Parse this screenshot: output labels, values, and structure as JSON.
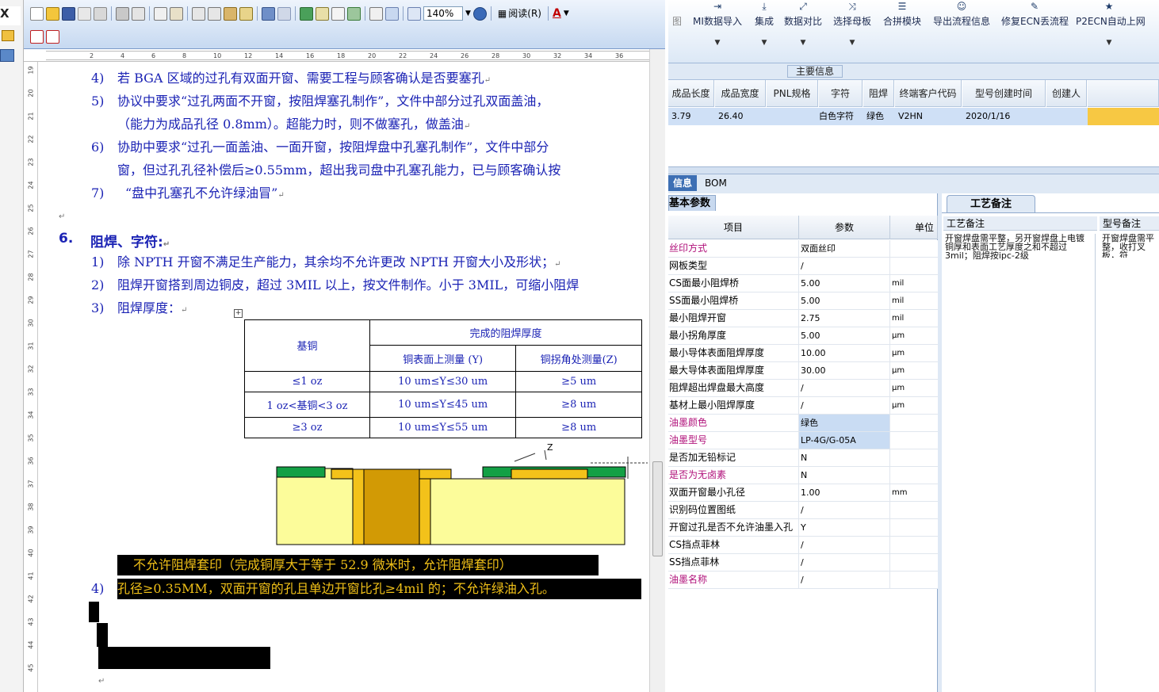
{
  "word": {
    "zoom": "140%",
    "read_label": "阅读(R)",
    "ruler_ticks": [
      "2",
      "4",
      "6",
      "8",
      "10",
      "12",
      "14",
      "16",
      "18",
      "20",
      "22",
      "24",
      "26",
      "28",
      "30",
      "32",
      "34",
      "36"
    ],
    "vruler_ticks": [
      "19",
      "20",
      "21",
      "22",
      "23",
      "24",
      "25",
      "26",
      "27",
      "28",
      "29",
      "30",
      "31",
      "32",
      "33",
      "34",
      "35",
      "36",
      "37",
      "38",
      "39",
      "40",
      "41",
      "42",
      "43",
      "44",
      "45"
    ],
    "items": [
      {
        "num": "4)",
        "text": "若 BGA 区域的过孔有双面开窗、需要工程与顾客确认是否要塞孔"
      },
      {
        "num": "5)",
        "text": "协议中要求“过孔两面不开窗，按阻焊塞孔制作”，文件中部分过孔双面盖油，",
        "cont": "（能力为成品孔径 0.8mm）。超能力时，则不做塞孔，做盖油"
      },
      {
        "num": "6)",
        "text": "协助中要求“过孔一面盖油、一面开窗，按阻焊盘中孔塞孔制作”，文件中部分",
        "cont": "窗，但过孔孔径补偿后≥0.55mm，超出我司盘中孔塞孔能力，已与顾客确认按"
      },
      {
        "num": "7)",
        "text": "“盘中孔塞孔不允许绿油冒”"
      }
    ],
    "section_num": "6.",
    "section_title": "阻焊、字符:",
    "items2": [
      {
        "num": "1)",
        "text": "除 NPTH 开窗不满足生产能力，其余均不允许更改 NPTH 开窗大小及形状；"
      },
      {
        "num": "2)",
        "text": "阻焊开窗搭到周边铜皮，超过 3MIL 以上，按文件制作。小于 3MIL，可缩小阻焊"
      },
      {
        "num": "3)",
        "text": "阻焊厚度："
      }
    ],
    "table": {
      "corner": "基铜",
      "group": "完成的阻焊厚度",
      "col1": "铜表面上测量 (Y)",
      "col2": "铜拐角处测量(Z)",
      "rows": [
        [
          "≤1 oz",
          "10 um≤Y≤30 um",
          "≥5 um"
        ],
        [
          "1 oz<基铜<3 oz",
          "10 um≤Y≤45 um",
          "≥8 um"
        ],
        [
          "≥3 oz",
          "10 um≤Y≤55 um",
          "≥8 um"
        ]
      ]
    },
    "fig_label": "Z",
    "item4_num": "4)",
    "hl_line1": "不允许阻焊套印（完成铜厚大于等于 52.9 微米时，允许阻焊套印）",
    "hl_line2": "孔径≥0.35MM，双面开窗的孔且单边开窗比孔≥4mil 的；不允许绿油入孔。"
  },
  "ribbon": {
    "buttons": [
      "MI数据导入",
      "集成",
      "数据对比",
      "选择母板",
      "合拼模块",
      "导出流程信息",
      "修复ECN丢流程",
      "P2ECN自动上网"
    ],
    "partial": "图",
    "main_info": "主要信息"
  },
  "grid1": {
    "headers": [
      "成品长度",
      "成品宽度",
      "PNL规格",
      "字符",
      "阻焊",
      "终端客户代码",
      "型号创建时间",
      "创建人"
    ],
    "row": [
      "3.79",
      "26.40",
      "",
      "白色字符",
      "绿色",
      "V2HN",
      "2020/1/16",
      ""
    ]
  },
  "tabs": [
    "信息",
    "BOM"
  ],
  "params": {
    "title": "基本参数",
    "headers": [
      "项目",
      "参数",
      "单位"
    ],
    "rows": [
      {
        "item": "丝印方式",
        "value": "双面丝印",
        "unit": "",
        "mag": true,
        "blue": false
      },
      {
        "item": "网板类型",
        "value": "/",
        "unit": "",
        "mag": false,
        "blue": false
      },
      {
        "item": "CS面最小阻焊桥",
        "value": "5.00",
        "unit": "mil",
        "mag": false,
        "blue": false
      },
      {
        "item": "SS面最小阻焊桥",
        "value": "5.00",
        "unit": "mil",
        "mag": false,
        "blue": false
      },
      {
        "item": "最小阻焊开窗",
        "value": "2.75",
        "unit": "mil",
        "mag": false,
        "blue": false
      },
      {
        "item": "最小拐角厚度",
        "value": "5.00",
        "unit": "μm",
        "mag": false,
        "blue": false
      },
      {
        "item": "最小导体表面阻焊厚度",
        "value": "10.00",
        "unit": "μm",
        "mag": false,
        "blue": false
      },
      {
        "item": "最大导体表面阻焊厚度",
        "value": "30.00",
        "unit": "μm",
        "mag": false,
        "blue": false
      },
      {
        "item": "阻焊超出焊盘最大高度",
        "value": "/",
        "unit": "μm",
        "mag": false,
        "blue": false
      },
      {
        "item": "基材上最小阻焊厚度",
        "value": "/",
        "unit": "μm",
        "mag": false,
        "blue": false
      },
      {
        "item": "油墨颜色",
        "value": "绿色",
        "unit": "",
        "mag": true,
        "blue": true
      },
      {
        "item": "油墨型号",
        "value": "LP-4G/G-05A",
        "unit": "",
        "mag": true,
        "blue": true
      },
      {
        "item": "是否加无铅标记",
        "value": "N",
        "unit": "",
        "mag": false,
        "blue": false
      },
      {
        "item": "是否为无卤素",
        "value": "N",
        "unit": "",
        "mag": true,
        "blue": false
      },
      {
        "item": "双面开窗最小孔径",
        "value": "1.00",
        "unit": "mm",
        "mag": false,
        "blue": false
      },
      {
        "item": "识别码位置图纸",
        "value": "/",
        "unit": "",
        "mag": false,
        "blue": false
      },
      {
        "item": "开窗过孔是否不允许油墨入孔",
        "value": "Y",
        "unit": "",
        "mag": false,
        "blue": false
      },
      {
        "item": "CS挡点菲林",
        "value": "/",
        "unit": "",
        "mag": false,
        "blue": false
      },
      {
        "item": "SS挡点菲林",
        "value": "/",
        "unit": "",
        "mag": false,
        "blue": false
      },
      {
        "item": "油墨名称",
        "value": "/",
        "unit": "",
        "mag": true,
        "blue": false
      }
    ]
  },
  "notes": {
    "tab": "工艺备注",
    "col1": "工艺备注",
    "col2": "型号备注",
    "text1": "开窗焊盘需平整，另开窗焊盘上电镀铜厚和表面工艺厚度之和不超过3mil；阻焊按ipc-2级",
    "text2": "开窗焊盘需平整，收打叉板，符"
  }
}
